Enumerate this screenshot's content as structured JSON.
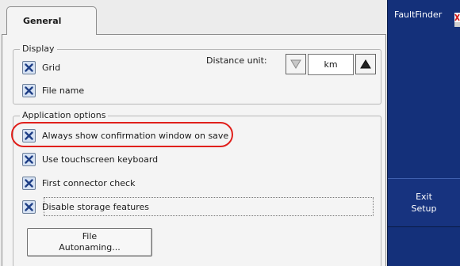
{
  "tabs": [
    {
      "label": "General"
    }
  ],
  "display": {
    "title": "Display",
    "grid_label": "Grid",
    "file_name_label": "File name",
    "distance_unit_label": "Distance unit:",
    "distance_unit_value": "km"
  },
  "app_options": {
    "title": "Application options",
    "items": [
      {
        "label": "Always show confirmation window on save",
        "checked": true
      },
      {
        "label": "Use touchscreen keyboard",
        "checked": true
      },
      {
        "label": "First connector check",
        "checked": true
      },
      {
        "label": "Disable storage features",
        "checked": true
      }
    ],
    "file_button": {
      "line1": "File",
      "line2": "Autonaming..."
    }
  },
  "side_panel": {
    "title": "FaultFinder",
    "exit_line1": "Exit",
    "exit_line2": "Setup"
  },
  "colors": {
    "side_panel_bg": "#14307a",
    "highlight": "#e0201c",
    "checkbox_bg": "#d6e2f3",
    "check_mark": "#1f3f86"
  },
  "icons": {
    "checkbox": "x-check-icon",
    "down_arrow": "triangle-down-icon",
    "up_arrow": "triangle-up-icon",
    "close": "close-icon"
  }
}
